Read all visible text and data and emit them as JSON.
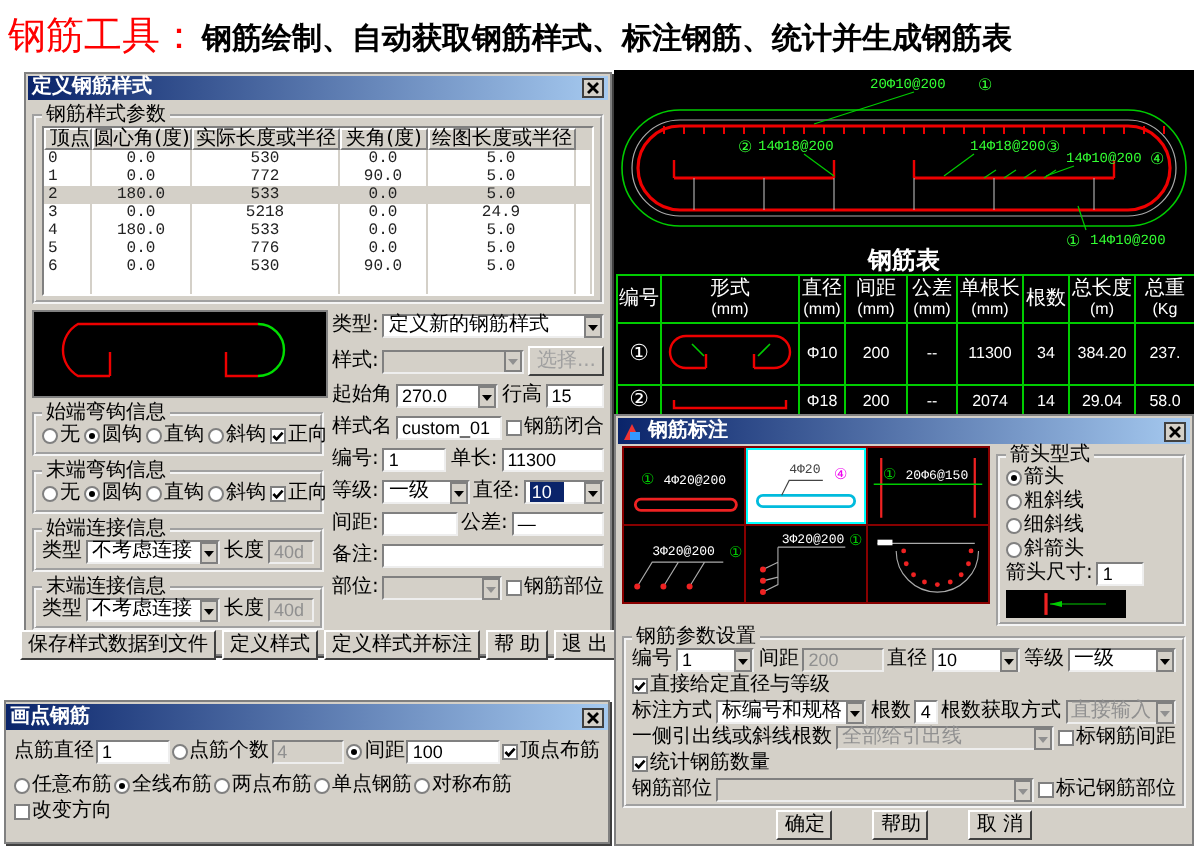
{
  "headline": {
    "title": "钢筋工具：",
    "subtitle": "钢筋绘制、自动获取钢筋样式、标注钢筋、统计并生成钢筋表"
  },
  "style_dialog": {
    "title": "定义钢筋样式",
    "table_group": "钢筋样式参数",
    "columns": [
      "顶点",
      "圆心角(度)",
      "实际长度或半径",
      "夹角(度)",
      "绘图长度或半径"
    ],
    "rows": [
      {
        "cells": [
          "0",
          "0.0",
          "530",
          "0.0",
          "5.0"
        ],
        "selected": false
      },
      {
        "cells": [
          "1",
          "0.0",
          "772",
          "90.0",
          "5.0"
        ],
        "selected": false
      },
      {
        "cells": [
          "2",
          "180.0",
          "533",
          "0.0",
          "5.0"
        ],
        "selected": true
      },
      {
        "cells": [
          "3",
          "0.0",
          "5218",
          "0.0",
          "24.9"
        ],
        "selected": false
      },
      {
        "cells": [
          "4",
          "180.0",
          "533",
          "0.0",
          "5.0"
        ],
        "selected": false
      },
      {
        "cells": [
          "5",
          "0.0",
          "776",
          "0.0",
          "5.0"
        ],
        "selected": false
      },
      {
        "cells": [
          "6",
          "0.0",
          "530",
          "90.0",
          "5.0"
        ],
        "selected": false
      }
    ],
    "groups": [
      {
        "legend": "始端弯钩信息",
        "controls": [
          {
            "kind": "radio",
            "text": "无",
            "selected": false
          },
          {
            "kind": "radio",
            "text": "圆钩",
            "selected": true
          },
          {
            "kind": "radio",
            "text": "直钩",
            "selected": false
          },
          {
            "kind": "radio",
            "text": "斜钩",
            "selected": false
          },
          {
            "kind": "checkbox",
            "text": "正向",
            "checked": true
          }
        ]
      },
      {
        "legend": "末端弯钩信息",
        "controls": [
          {
            "kind": "radio",
            "text": "无",
            "selected": false
          },
          {
            "kind": "radio",
            "text": "圆钩",
            "selected": true
          },
          {
            "kind": "radio",
            "text": "直钩",
            "selected": false
          },
          {
            "kind": "radio",
            "text": "斜钩",
            "selected": false
          },
          {
            "kind": "checkbox",
            "text": "正向",
            "checked": true
          }
        ]
      },
      {
        "legend": "始端连接信息",
        "controls": [
          {
            "kind": "label",
            "text": "类型"
          },
          {
            "kind": "select",
            "value": "不考虑连接"
          },
          {
            "kind": "label",
            "text": "长度"
          },
          {
            "kind": "input",
            "value": "40d",
            "disabled": true
          }
        ]
      },
      {
        "legend": "末端连接信息",
        "controls": [
          {
            "kind": "label",
            "text": "类型"
          },
          {
            "kind": "select",
            "value": "不考虑连接"
          },
          {
            "kind": "label",
            "text": "长度"
          },
          {
            "kind": "input",
            "value": "40d",
            "disabled": true
          }
        ]
      }
    ],
    "fields": [
      [
        {
          "kind": "label",
          "text": "类型:"
        },
        {
          "kind": "select",
          "value": "定义新的钢筋样式"
        }
      ],
      [
        {
          "kind": "label",
          "text": "样式:"
        },
        {
          "kind": "select",
          "disabled": true
        },
        {
          "kind": "button",
          "text": "选择...",
          "disabled": true
        }
      ],
      [
        {
          "kind": "label",
          "text": "起始角"
        },
        {
          "kind": "select",
          "value": "270.0"
        },
        {
          "kind": "label",
          "text": "行高"
        },
        {
          "kind": "input",
          "value": "15"
        }
      ],
      [
        {
          "kind": "label",
          "text": "样式名"
        },
        {
          "kind": "input",
          "value": "custom_01"
        },
        {
          "kind": "checkbox",
          "text": "钢筋闭合",
          "checked": false
        }
      ],
      [
        {
          "kind": "label",
          "text": "编号:"
        },
        {
          "kind": "input",
          "value": "1"
        },
        {
          "kind": "label",
          "text": "单长:"
        },
        {
          "kind": "input",
          "value": "11300"
        }
      ],
      [
        {
          "kind": "label",
          "text": "等级:"
        },
        {
          "kind": "select",
          "value": "一级"
        },
        {
          "kind": "label",
          "text": "直径:"
        },
        {
          "kind": "select",
          "value": "10",
          "focused": true
        }
      ],
      [
        {
          "kind": "label",
          "text": "间距:"
        },
        {
          "kind": "input"
        },
        {
          "kind": "label",
          "text": "公差:"
        },
        {
          "kind": "input",
          "value": "—"
        }
      ],
      [
        {
          "kind": "label",
          "text": "备注:"
        },
        {
          "kind": "input"
        }
      ],
      [
        {
          "kind": "label",
          "text": "部位:"
        },
        {
          "kind": "select",
          "disabled": true
        },
        {
          "kind": "checkbox",
          "text": "钢筋部位",
          "checked": false
        }
      ]
    ],
    "buttons": [
      {
        "kind": "button",
        "text": "保存样式数据到文件"
      },
      {
        "kind": "button",
        "text": "定义样式"
      },
      {
        "kind": "button",
        "text": "定义样式并标注"
      },
      {
        "kind": "button",
        "text": "帮 助"
      },
      {
        "kind": "button",
        "text": "退 出"
      }
    ]
  },
  "cad_drawing": {
    "labels": [
      {
        "text": "20Φ10@200",
        "number": "①"
      },
      {
        "text": "14Φ18@200",
        "number": "②"
      },
      {
        "text": "14Φ18@200",
        "number": "③"
      },
      {
        "text": "14Φ10@200",
        "number": "④"
      },
      {
        "text": "14Φ10@200",
        "number": "①"
      }
    ],
    "table_title": "钢筋表",
    "columns": [
      {
        "name": "编号"
      },
      {
        "name": "形式",
        "unit": "(mm)"
      },
      {
        "name": "直径",
        "unit": "(mm)"
      },
      {
        "name": "间距",
        "unit": "(mm)"
      },
      {
        "name": "公差",
        "unit": "(mm)"
      },
      {
        "name": "单根长",
        "unit": "(mm)"
      },
      {
        "name": "根数"
      },
      {
        "name": "总长度",
        "unit": "(m)"
      },
      {
        "name": "总重",
        "unit": "(Kg"
      }
    ],
    "rows": [
      {
        "kind": "stadium",
        "cells": [
          "①",
          "",
          "Φ10",
          "200",
          "--",
          "11300",
          "34",
          "384.20",
          "237."
        ]
      },
      {
        "kind": "straight",
        "cells": [
          "②",
          "",
          "Φ18",
          "200",
          "--",
          "2074",
          "14",
          "29.04",
          "58.0"
        ]
      }
    ]
  },
  "dot_dialog": {
    "title": "画点钢筋",
    "lines": [
      {
        "controls": [
          {
            "kind": "label",
            "text": "点筋直径"
          },
          {
            "kind": "input",
            "value": "1"
          },
          {
            "kind": "radio",
            "text": "点筋个数",
            "selected": false
          },
          {
            "kind": "input",
            "value": "4",
            "disabled": true
          },
          {
            "kind": "radio",
            "text": "间距",
            "selected": true
          },
          {
            "kind": "input",
            "value": "100"
          },
          {
            "kind": "checkbox",
            "text": "顶点布筋",
            "checked": true
          }
        ]
      },
      {
        "controls": [
          {
            "kind": "radio",
            "text": "任意布筋",
            "selected": false
          },
          {
            "kind": "radio",
            "text": "全线布筋",
            "selected": true
          },
          {
            "kind": "radio",
            "text": "两点布筋",
            "selected": false
          },
          {
            "kind": "radio",
            "text": "单点钢筋",
            "selected": false
          },
          {
            "kind": "radio",
            "text": "对称布筋",
            "selected": false
          },
          {
            "kind": "checkbox",
            "text": "改变方向",
            "checked": false
          }
        ]
      }
    ]
  },
  "mark_dialog": {
    "title": "钢筋标注",
    "previews": [
      {
        "kind": "bar",
        "number": "①",
        "text": "4Φ20@200",
        "selected": false
      },
      {
        "kind": "hook",
        "text": "4Φ20",
        "number": "④",
        "selected": true
      },
      {
        "kind": "section",
        "number": "①",
        "text": "20Φ6@150",
        "selected": false
      },
      {
        "kind": "fan",
        "text": "3Φ20@200",
        "number": "①",
        "selected": false
      },
      {
        "kind": "column",
        "text": "3Φ20@200",
        "number": "①",
        "selected": false
      },
      {
        "kind": "arc",
        "selected": false
      }
    ],
    "arrow_group": {
      "legend": "箭头型式",
      "controls": [
        {
          "kind": "radio",
          "text": "箭头",
          "selected": true
        },
        {
          "kind": "radio",
          "text": "粗斜线",
          "selected": false
        },
        {
          "kind": "radio",
          "text": "细斜线",
          "selected": false
        },
        {
          "kind": "radio",
          "text": "斜箭头",
          "selected": false
        },
        {
          "kind": "label",
          "text": "箭头尺寸:"
        },
        {
          "kind": "input",
          "value": "1"
        }
      ]
    },
    "params_legend": "钢筋参数设置",
    "lines": [
      {
        "controls": [
          {
            "kind": "label",
            "text": "编号"
          },
          {
            "kind": "select",
            "value": "1"
          },
          {
            "kind": "label",
            "text": "间距"
          },
          {
            "kind": "input",
            "value": "200",
            "disabled": true
          },
          {
            "kind": "label",
            "text": "直径"
          },
          {
            "kind": "select",
            "value": "10"
          },
          {
            "kind": "label",
            "text": "等级"
          },
          {
            "kind": "select",
            "value": "一级"
          },
          {
            "kind": "checkbox",
            "text": "直接给定直径与等级",
            "checked": true
          }
        ]
      },
      {
        "controls": [
          {
            "kind": "label",
            "text": "标注方式"
          },
          {
            "kind": "select",
            "value": "标编号和规格"
          },
          {
            "kind": "label",
            "text": "根数"
          },
          {
            "kind": "input",
            "value": "4"
          },
          {
            "kind": "label",
            "text": "根数获取方式"
          },
          {
            "kind": "select",
            "value": "直接输入",
            "disabled": true
          }
        ]
      },
      {
        "controls": [
          {
            "kind": "label",
            "text": "一侧引出线或斜线根数"
          },
          {
            "kind": "select",
            "value": "全部给引出线",
            "disabled": true
          },
          {
            "kind": "checkbox",
            "text": "标钢筋间距",
            "checked": false
          },
          {
            "kind": "checkbox",
            "text": "统计钢筋数量",
            "checked": true
          }
        ]
      },
      {
        "controls": [
          {
            "kind": "label",
            "text": "钢筋部位"
          },
          {
            "kind": "select",
            "disabled": true
          },
          {
            "kind": "checkbox",
            "text": "标记钢筋部位",
            "checked": false
          }
        ]
      }
    ],
    "buttons": [
      {
        "kind": "button",
        "text": "确定"
      },
      {
        "kind": "button",
        "text": "帮助"
      },
      {
        "kind": "button",
        "text": "取 消"
      }
    ]
  }
}
